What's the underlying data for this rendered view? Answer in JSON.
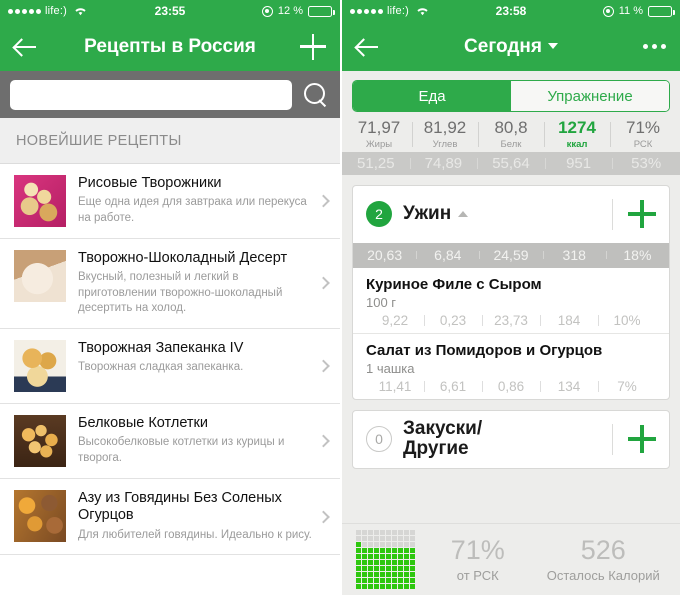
{
  "left": {
    "statusbar": {
      "carrier": "life:)",
      "time": "23:55",
      "battery_text": "12 %",
      "battery_level": 12
    },
    "navbar": {
      "title": "Рецепты в Россия",
      "back_icon": "back-arrow-icon",
      "add_icon": "plus-icon"
    },
    "search": {
      "value": "",
      "placeholder": "",
      "icon": "search-icon"
    },
    "section_header": "НОВЕЙШИЕ РЕЦЕПТЫ",
    "recipes": [
      {
        "title": "Рисовые Творожники",
        "desc": "Еще одна идея для завтрака или перекуса на работе.",
        "thumb": "th1"
      },
      {
        "title": "Творожно-Шоколадный Десерт",
        "desc": "Вкусный, полезный и легкий в приготовлении творожно-шоколадный десертить на холод.",
        "thumb": "th2"
      },
      {
        "title": "Творожная Запеканка IV",
        "desc": "Творожная сладкая запеканка.",
        "thumb": "th3"
      },
      {
        "title": "Белковые Котлетки",
        "desc": "Высокобелковые котлетки из курицы и творога.",
        "thumb": "th4"
      },
      {
        "title": "Азу из Говядины Без Соленых Огурцов",
        "desc": "Для любителей говядины. Идеально к рису.",
        "thumb": "th5"
      }
    ]
  },
  "right": {
    "statusbar": {
      "carrier": "life:)",
      "time": "23:58",
      "battery_text": "11 %",
      "battery_level": 11
    },
    "navbar": {
      "title": "Сегодня",
      "back_icon": "back-arrow-icon",
      "more_icon": "more-dots-icon"
    },
    "segments": {
      "food": "Еда",
      "exercise": "Упражнение",
      "active": "food"
    },
    "macros": [
      {
        "value": "71,97",
        "label": "Жиры",
        "sub": "51,25"
      },
      {
        "value": "81,92",
        "label": "Углев",
        "sub": "74,89"
      },
      {
        "value": "80,8",
        "label": "Белк",
        "sub": "55,64"
      },
      {
        "value": "1274",
        "label": "ккал",
        "sub": "951"
      },
      {
        "value": "71%",
        "label": "РСК",
        "sub": "53%"
      }
    ],
    "meals": [
      {
        "count": "2",
        "name": "Ужин",
        "expanded": true,
        "totals": [
          "20,63",
          "6,84",
          "24,59",
          "318",
          "18%"
        ],
        "foods": [
          {
            "name": "Куриное Филе с Сыром",
            "serving": "100 г",
            "nums": [
              "9,22",
              "0,23",
              "23,73",
              "184",
              "10%"
            ]
          },
          {
            "name": "Салат из Помидоров и Огурцов",
            "serving": "1 чашка",
            "nums": [
              "11,41",
              "6,61",
              "0,86",
              "134",
              "7%"
            ]
          }
        ]
      },
      {
        "count": "0",
        "name": "Закуски/\nДругие",
        "expanded": false,
        "totals": [],
        "foods": []
      }
    ],
    "footer": {
      "grid_percent": 71,
      "percent_value": "71%",
      "percent_label": "от РСК",
      "remaining_value": "526",
      "remaining_label": "Осталось Калорий"
    }
  },
  "colors": {
    "brand_green": "#2eaa4a",
    "accent_green": "#21a53f",
    "grid_green": "#2ec70f",
    "battery_red": "#e8453c",
    "search_bar_gray": "#6e6e6e",
    "page_bg": "#ededeb"
  }
}
